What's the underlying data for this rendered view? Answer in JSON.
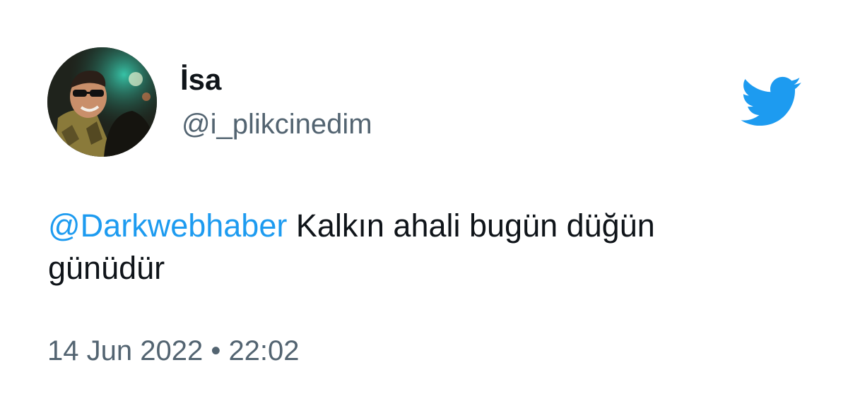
{
  "tweet": {
    "author": {
      "display_name": "İsa",
      "handle": "@i_plikcinedim"
    },
    "body": {
      "mention": "@Darkwebhaber",
      "text": " Kalkın ahali bugün düğün günüdür"
    },
    "timestamp": {
      "date": "14 Jun 2022",
      "separator": " • ",
      "time": "22:02"
    }
  },
  "icons": {
    "brand": "twitter-bird-icon",
    "avatar": "profile-photo"
  },
  "colors": {
    "brand": "#1d9bf0",
    "text_primary": "#0f1419",
    "text_secondary": "#536471"
  }
}
